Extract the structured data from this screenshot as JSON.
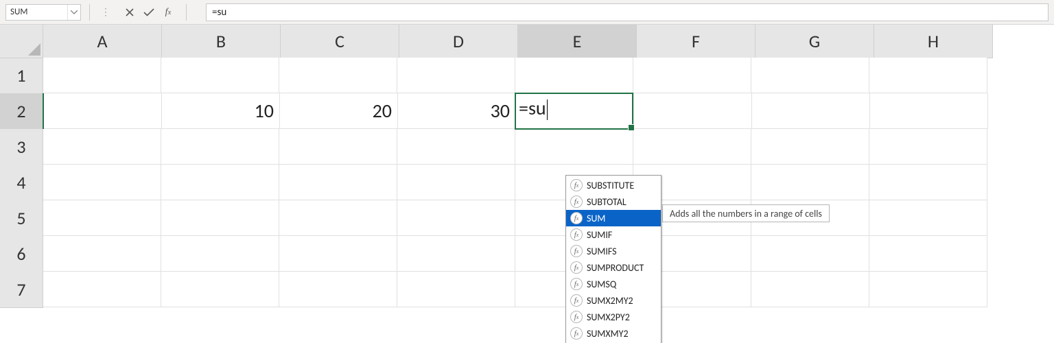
{
  "formula_bar": {
    "name_box_value": "SUM",
    "formula_input_value": "=su"
  },
  "columns": [
    "A",
    "B",
    "C",
    "D",
    "E",
    "F",
    "G",
    "H"
  ],
  "rows": [
    "1",
    "2",
    "3",
    "4",
    "5",
    "6",
    "7"
  ],
  "active_cell": {
    "address": "E2",
    "editing_text": "=su",
    "highlight_row_index": 1,
    "highlight_col_index": 4
  },
  "cells": {
    "B2": "10",
    "C2": "20",
    "D2": "30"
  },
  "autocomplete": {
    "items": [
      {
        "label": "SUBSTITUTE"
      },
      {
        "label": "SUBTOTAL"
      },
      {
        "label": "SUM",
        "selected": true
      },
      {
        "label": "SUMIF"
      },
      {
        "label": "SUMIFS"
      },
      {
        "label": "SUMPRODUCT"
      },
      {
        "label": "SUMSQ"
      },
      {
        "label": "SUMX2MY2"
      },
      {
        "label": "SUMX2PY2"
      },
      {
        "label": "SUMXMY2"
      }
    ],
    "tooltip": "Adds all the numbers in a range of cells"
  },
  "colors": {
    "selection_green": "#217346",
    "highlight_blue": "#0a64c8"
  }
}
